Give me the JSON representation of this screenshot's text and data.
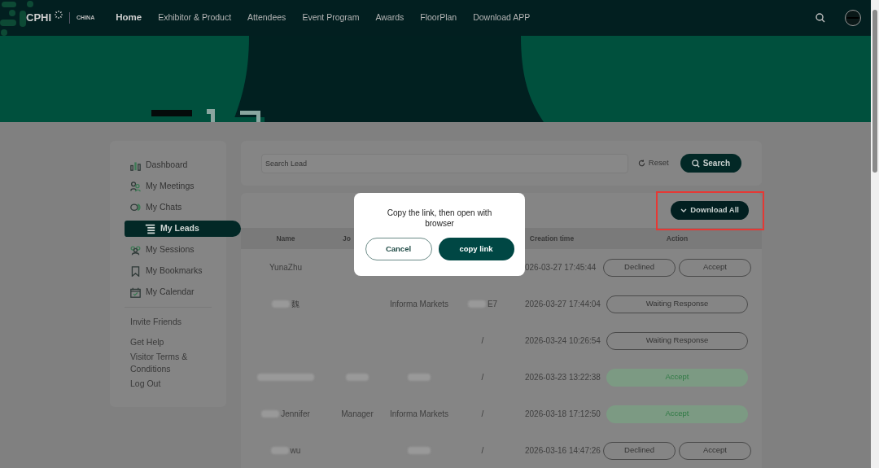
{
  "nav": {
    "logo": "CPHI",
    "logo_sub": "CHINA",
    "items": [
      {
        "label": "Home",
        "selected": true
      },
      {
        "label": "Exhibitor & Product",
        "selected": false
      },
      {
        "label": "Attendees",
        "selected": false
      },
      {
        "label": "Event Program",
        "selected": false
      },
      {
        "label": "Awards",
        "selected": false
      },
      {
        "label": "FloorPlan",
        "selected": false
      },
      {
        "label": "Download APP",
        "selected": false
      }
    ]
  },
  "sidebar": {
    "items": [
      {
        "label": "Dashboard",
        "kind": "chart",
        "selected": false
      },
      {
        "label": "My Meetings",
        "kind": "people",
        "selected": false
      },
      {
        "label": "My Chats",
        "kind": "chat",
        "selected": false
      },
      {
        "label": "My Leads",
        "kind": "list",
        "selected": true
      },
      {
        "label": "My Sessions",
        "kind": "group",
        "selected": false
      },
      {
        "label": "My Bookmarks",
        "kind": "bookmark",
        "selected": false
      },
      {
        "label": "My Calendar",
        "kind": "calendar",
        "selected": false
      }
    ],
    "links": [
      "Invite Friends",
      "Get Help",
      "Visitor Terms & Conditions",
      "Log Out"
    ]
  },
  "search": {
    "placeholder": "Search Lead",
    "reset": "Reset",
    "button": "Search"
  },
  "download_button": "Download All",
  "table": {
    "columns": [
      {
        "label": "Name"
      },
      {
        "label": "Jo"
      },
      {},
      {},
      {
        "label": "Creation time"
      },
      {
        "label": "Action"
      }
    ],
    "rows": [
      {
        "cells": [
          {
            "text": "YunaZhu",
            "blurred": false
          },
          {
            "blurred": false
          },
          {
            "blurred": false
          },
          {
            "blurred": false
          },
          {
            "text": "026-03-27 17:45:44",
            "blurred": false
          }
        ],
        "action": {
          "kind": "choice",
          "labels": [
            "Declined",
            "Accept"
          ]
        }
      },
      {
        "cells": [
          {
            "text": "魏",
            "blurred": true
          },
          {
            "blurred": false
          },
          {
            "text": "Informa Markets",
            "blurred": false
          },
          {
            "text": "E7",
            "blurred": true
          },
          {
            "text": "2026-03-27 17:44:04",
            "blurred": false
          }
        ],
        "action": {
          "kind": "waiting",
          "labels": [
            "Waiting Response"
          ]
        }
      },
      {
        "cells": [
          {
            "blurred": false
          },
          {
            "blurred": false
          },
          {
            "blurred": false
          },
          {
            "text": "/",
            "blurred": false
          },
          {
            "text": "2026-03-24 10:26:54",
            "blurred": false
          }
        ],
        "action": {
          "kind": "waiting",
          "labels": [
            "Waiting Response"
          ]
        }
      },
      {
        "cells": [
          {
            "blurred": true
          },
          {
            "blurred": true
          },
          {
            "blurred": true
          },
          {
            "text": "/",
            "blurred": false
          },
          {
            "text": "2026-03-23 13:22:38",
            "blurred": false
          }
        ],
        "action": {
          "kind": "accepted",
          "labels": [
            "Accept"
          ]
        }
      },
      {
        "cells": [
          {
            "text": "Jennifer",
            "blurred": true
          },
          {
            "text": "Manager",
            "blurred": false
          },
          {
            "text": "Informa Markets",
            "blurred": false
          },
          {
            "text": "/",
            "blurred": false
          },
          {
            "text": "2026-03-18 17:12:50",
            "blurred": false
          }
        ],
        "action": {
          "kind": "accepted",
          "labels": [
            "Accept"
          ]
        }
      },
      {
        "cells": [
          {
            "text": "wu",
            "blurred": true
          },
          {
            "blurred": false
          },
          {
            "blurred": true
          },
          {
            "text": "/",
            "blurred": false
          },
          {
            "text": "2026-03-16 14:47:26",
            "blurred": false
          }
        ],
        "action": {
          "kind": "choice",
          "labels": [
            "Declined",
            "Accept"
          ]
        }
      }
    ]
  },
  "dialog": {
    "message": "Copy the link, then open with browser",
    "cancel": "Cancel",
    "confirm": "copy link"
  }
}
